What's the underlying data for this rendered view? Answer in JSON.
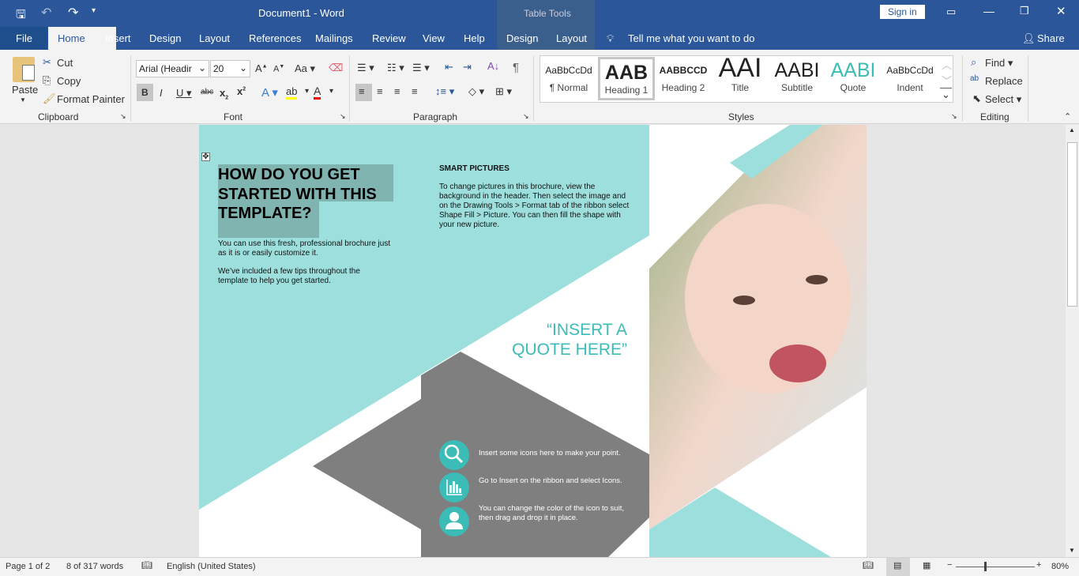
{
  "window": {
    "title": "Document1  -  Word",
    "contextual": "Table Tools",
    "sign_in": "Sign in",
    "share": "Share"
  },
  "tabs": [
    "File",
    "Home",
    "Insert",
    "Design",
    "Layout",
    "References",
    "Mailings",
    "Review",
    "View",
    "Help",
    "Design",
    "Layout"
  ],
  "tell_me": "Tell me what you want to do",
  "clipboard": {
    "paste": "Paste",
    "cut": "Cut",
    "copy": "Copy",
    "format_painter": "Format Painter",
    "label": "Clipboard"
  },
  "font": {
    "name": "Arial (Headir",
    "size": "20",
    "label": "Font",
    "case": "Aa"
  },
  "paragraph": {
    "label": "Paragraph"
  },
  "styles": {
    "label": "Styles",
    "items": [
      {
        "preview": "AaBbCcDd",
        "name": "¶ Normal"
      },
      {
        "preview": "AAB",
        "name": "Heading 1"
      },
      {
        "preview": "AABBCCD",
        "name": "Heading 2"
      },
      {
        "preview": "AAI",
        "name": "Title"
      },
      {
        "preview": "AABI",
        "name": "Subtitle"
      },
      {
        "preview": "AABI",
        "name": "Quote"
      },
      {
        "preview": "AaBbCcDd",
        "name": "Indent"
      }
    ]
  },
  "editing": {
    "find": "Find",
    "replace": "Replace",
    "select": "Select",
    "label": "Editing"
  },
  "doc": {
    "heading": "HOW DO YOU GET STARTED WITH THIS TEMPLATE?",
    "p1": "You can use this fresh, professional brochure just as it is or easily customize it.",
    "p2": "We’ve included a few tips throughout the template to help you get started.",
    "smart_title": "SMART PICTURES",
    "smart_body": "To change pictures in this brochure, view the background in the header. Then select the image and on the Drawing Tools > Format tab of the ribbon select Shape Fill > Picture. You can then fill the shape with your new picture.",
    "quote": "“INSERT A QUOTE HERE”",
    "tips": [
      "Insert some icons here to make your point.",
      "Go to Insert on the ribbon and select Icons.",
      "You can change the color of the icon to suit, then drag and drop it in place."
    ],
    "colors": {
      "teal_light": "#9ddfdd",
      "teal": "#3bbcb6",
      "gray": "#7f7f7f"
    }
  },
  "status": {
    "page": "Page 1 of 2",
    "words": "8 of 317 words",
    "language": "English (United States)",
    "zoom": "80%",
    "zoom_percent": 80
  }
}
